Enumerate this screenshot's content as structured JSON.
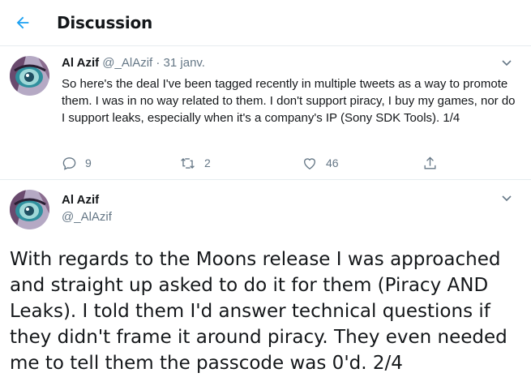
{
  "header": {
    "title": "Discussion",
    "back_icon": "arrow-left-icon",
    "accent": "#1da1f2"
  },
  "tweets": [
    {
      "name": "Al Azif",
      "handle": "@_AlAzif",
      "separator": "·",
      "date": "31 janv.",
      "text": "So here's the deal I've been tagged recently in multiple tweets as a way to promote them. I was in no way related to them. I don't support piracy, I buy my games, nor do I support leaks, especially when it's a company's IP (Sony SDK Tools). 1/4",
      "replies": "9",
      "retweets": "2",
      "likes": "46"
    },
    {
      "name": "Al Azif",
      "handle": "@_AlAzif",
      "text": "With regards to the Moons release I was approached and straight up asked to do it for them (Piracy AND Leaks). I told them I'd answer technical questions if they didn't frame it around piracy. They even needed me to tell them the passcode was 0'd. 2/4"
    }
  ],
  "colors": {
    "text": "#14171a",
    "secondary": "#657786",
    "divider": "#e6ecf0"
  }
}
